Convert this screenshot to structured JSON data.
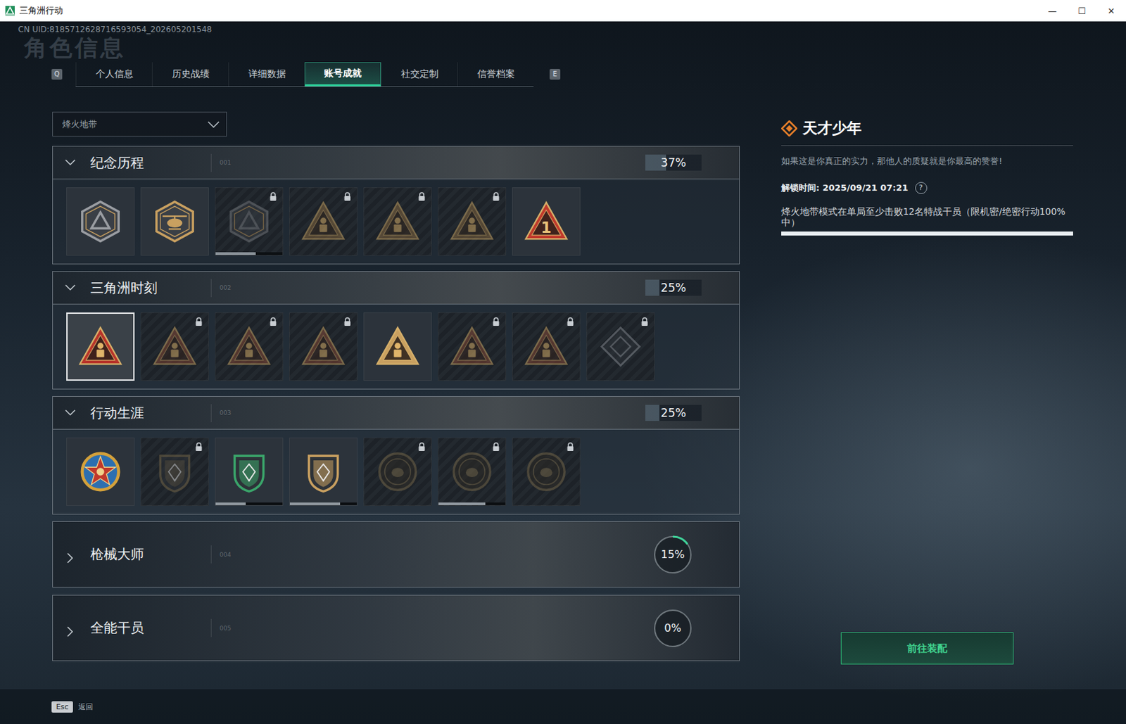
{
  "window": {
    "title": "三角洲行动",
    "controls": [
      "—",
      "☐",
      "✕"
    ]
  },
  "uid": "CN UID:8185712628716593054_202605201548",
  "page_watermark": "角色信息",
  "tabs": {
    "prev_key": "Q",
    "next_key": "E",
    "items": [
      {
        "label": "个人信息",
        "selected": false
      },
      {
        "label": "历史战绩",
        "selected": false
      },
      {
        "label": "详细数据",
        "selected": false
      },
      {
        "label": "账号成就",
        "selected": true
      },
      {
        "label": "社交定制",
        "selected": false
      },
      {
        "label": "信誉档案",
        "selected": false
      }
    ]
  },
  "mode_select": {
    "value": "烽火地带"
  },
  "sections": [
    {
      "title": "纪念历程",
      "number": "001",
      "percent": "37%",
      "level": 0.37,
      "expanded": true,
      "badges": [
        {
          "kind": "hexagon",
          "color": "#9a9da2",
          "locked": false,
          "selected": false,
          "level": 0
        },
        {
          "kind": "heli",
          "color": "#c9a060",
          "locked": false,
          "selected": false,
          "level": 0
        },
        {
          "kind": "hexagon",
          "color": "#7a7d82",
          "locked": true,
          "selected": false,
          "level": 0.6
        },
        {
          "kind": "triangle",
          "color": "#8a6a40",
          "locked": true,
          "selected": false,
          "level": 0
        },
        {
          "kind": "triangle",
          "color": "#8a6a40",
          "locked": true,
          "selected": false,
          "level": 0
        },
        {
          "kind": "triangle",
          "color": "#8a6a40",
          "locked": true,
          "selected": false,
          "level": 0
        },
        {
          "kind": "number",
          "color": "#c0392b",
          "locked": false,
          "selected": false,
          "level": 0,
          "text": "1"
        }
      ]
    },
    {
      "title": "三角洲时刻",
      "number": "002",
      "percent": "25%",
      "level": 0.25,
      "expanded": true,
      "badges": [
        {
          "kind": "triangle",
          "color": "#b8342a",
          "locked": false,
          "selected": true,
          "level": 0
        },
        {
          "kind": "triangle",
          "color": "#8a4a35",
          "locked": true,
          "selected": false,
          "level": 0
        },
        {
          "kind": "triangle",
          "color": "#8a4a35",
          "locked": true,
          "selected": false,
          "level": 0
        },
        {
          "kind": "triangle",
          "color": "#8a4a35",
          "locked": true,
          "selected": false,
          "level": 0
        },
        {
          "kind": "triangle",
          "color": "#c9a060",
          "locked": false,
          "selected": false,
          "level": 0
        },
        {
          "kind": "triangle",
          "color": "#8a4a35",
          "locked": true,
          "selected": false,
          "level": 0
        },
        {
          "kind": "triangle",
          "color": "#8a4a35",
          "locked": true,
          "selected": false,
          "level": 0
        },
        {
          "kind": "diamond",
          "color": "#8a8f96",
          "locked": true,
          "selected": false,
          "level": 0
        }
      ]
    },
    {
      "title": "行动生涯",
      "number": "003",
      "percent": "25%",
      "level": 0.25,
      "expanded": true,
      "badges": [
        {
          "kind": "crest",
          "color": "#d4a13a",
          "locked": false,
          "selected": false,
          "level": 0
        },
        {
          "kind": "shield",
          "color": "#7a6a4a",
          "locked": true,
          "selected": false,
          "level": 0
        },
        {
          "kind": "shield",
          "color": "#3aa56a",
          "locked": false,
          "selected": false,
          "level": 0.45
        },
        {
          "kind": "shield",
          "color": "#c9a060",
          "locked": false,
          "selected": false,
          "level": 0.75
        },
        {
          "kind": "coin",
          "color": "#7a6a4a",
          "locked": true,
          "selected": false,
          "level": 0
        },
        {
          "kind": "coin",
          "color": "#7a6a4a",
          "locked": true,
          "selected": false,
          "level": 0.7
        },
        {
          "kind": "coin",
          "color": "#7a6a4a",
          "locked": true,
          "selected": false,
          "level": 0
        }
      ]
    },
    {
      "title": "枪械大师",
      "number": "004",
      "percent": "15%",
      "level": 0.15,
      "expanded": false,
      "badges": []
    },
    {
      "title": "全能干员",
      "number": "005",
      "percent": "0%",
      "level": 0,
      "expanded": false,
      "badges": []
    }
  ],
  "detail": {
    "title": "天才少年",
    "description": "如果这是你真正的实力，那他人的质疑就是你最高的赞誉!",
    "unlock": "解锁时间: 2025/09/21 07:21",
    "help": "?",
    "requirement": "烽火地带模式在单局至少击败12名特战干员（限机密/绝密行动100%中）",
    "level": 1,
    "button": "前往装配"
  },
  "footer": {
    "key": "Esc",
    "label": "返回"
  }
}
